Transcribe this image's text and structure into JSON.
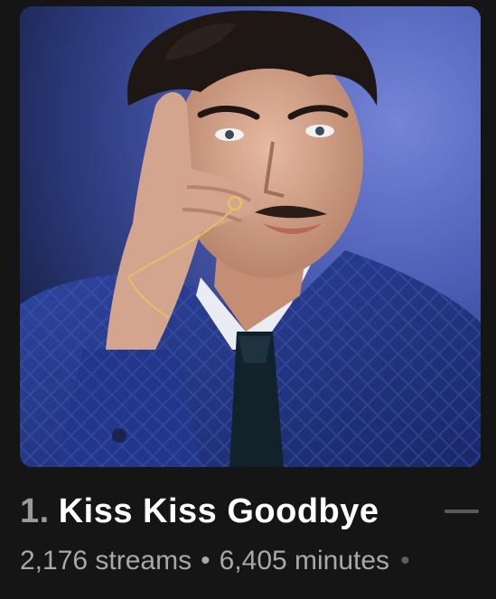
{
  "track": {
    "rank": "1.",
    "title": "Kiss Kiss Goodbye",
    "streams": "2,176 streams",
    "separator": "•",
    "minutes": "6,405 minutes",
    "trailing_dot": "•"
  },
  "artwork": {
    "description_icon": "album-artwork",
    "background_color": "#4a5bb0",
    "jacket_color": "#23336e",
    "hair_color": "#1f1714",
    "skin_color": "#d4a58e"
  },
  "menu": {
    "icon": "collapse-dash-icon"
  }
}
